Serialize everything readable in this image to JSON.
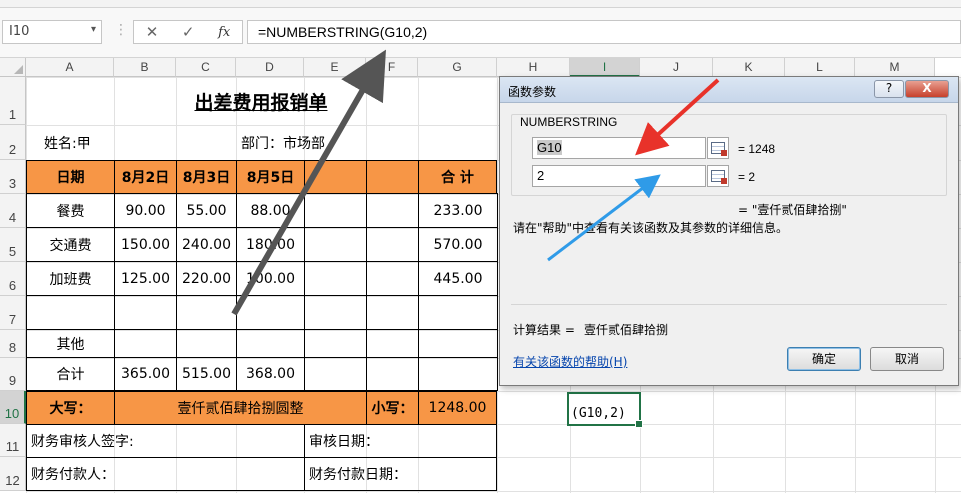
{
  "app": {
    "name_box": "I10",
    "formula": "=NUMBERSTRING(G10,2)",
    "formula_buttons": [
      "cancel-icon",
      "enter-icon",
      "fx-icon"
    ],
    "colors": {
      "accent": "#217346",
      "header_fill": "#f79646",
      "arrow_red": "#e8322a",
      "arrow_blue": "#2f9be8",
      "arrow_dark": "#555555"
    }
  },
  "columns": [
    "A",
    "B",
    "C",
    "D",
    "E",
    "F",
    "G",
    "H",
    "I",
    "J",
    "K",
    "L",
    "M"
  ],
  "rows": [
    "1",
    "2",
    "3",
    "4",
    "5",
    "6",
    "7",
    "8",
    "9",
    "10",
    "11",
    "12"
  ],
  "sheet": {
    "title": "出差费用报销单",
    "name_label": "姓名:甲",
    "dept_label": "部门：市场部",
    "header": {
      "date": "日期",
      "d1": "8月2日",
      "d2": "8月3日",
      "d3": "8月5日",
      "total": "合 计"
    },
    "rows": [
      {
        "label": "餐费",
        "d1": "90.00",
        "d2": "55.00",
        "d3": "88.00",
        "total": "233.00"
      },
      {
        "label": "交通费",
        "d1": "150.00",
        "d2": "240.00",
        "d3": "180.00",
        "total": "570.00"
      },
      {
        "label": "加班费",
        "d1": "125.00",
        "d2": "220.00",
        "d3": "100.00",
        "total": "445.00"
      },
      {
        "label": "",
        "d1": "",
        "d2": "",
        "d3": "",
        "total": ""
      },
      {
        "label": "其他",
        "d1": "",
        "d2": "",
        "d3": "",
        "total": ""
      },
      {
        "label": "合计",
        "d1": "365.00",
        "d2": "515.00",
        "d3": "368.00",
        "total": ""
      }
    ],
    "daxie_label": "大写：",
    "daxie_value": "壹仟贰佰肆拾捌圆整",
    "xiaoxie_label": "小写：",
    "xiaoxie_value": "1248.00",
    "auditor_label": "财务审核人签字:",
    "audit_date_label": "审核日期：",
    "payer_label": "财务付款人：",
    "pay_date_label": "财务付款日期：",
    "active_cell_text": "(G10,2)"
  },
  "dialog": {
    "title": "函数参数",
    "help_btn": "?",
    "close_btn": "X",
    "function_name": "NUMBERSTRING",
    "arg1_value": "G10",
    "arg1_result": "=  1248",
    "arg2_value": "2",
    "arg2_result": "=  2",
    "formula_result_line": "=  \"壹仟贰佰肆拾捌\"",
    "help_text": "请在\"帮助\"中查看有关该函数及其参数的详细信息。",
    "calc_result_label": "计算结果 =",
    "calc_result_value": "壹仟贰佰肆拾捌",
    "help_link": "有关该函数的帮助(H)",
    "ok": "确定",
    "cancel": "取消"
  }
}
